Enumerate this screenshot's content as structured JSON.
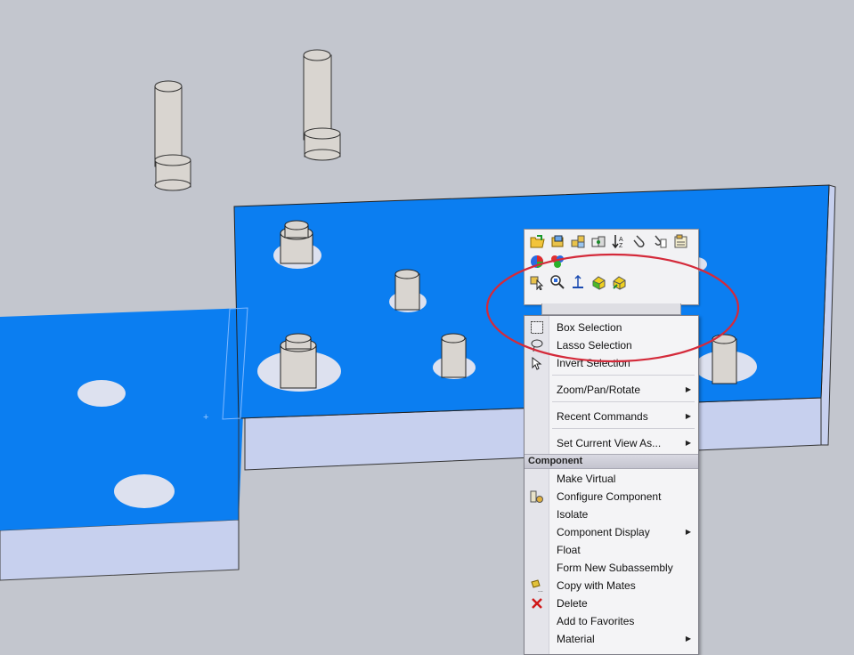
{
  "toolbar": {
    "icons": [
      "open-part-icon",
      "open-assembly-icon",
      "assembly-icon",
      "mates-icon",
      "sort-icon",
      "attach-icon",
      "attach-file-icon",
      "properties-icon",
      "appearance-icon",
      "color-icon",
      "select-other-icon",
      "zoom-to-selection-icon",
      "normal-to-icon",
      "hide-icon",
      "show-icon"
    ]
  },
  "menu": {
    "items": [
      {
        "label": "Box Selection",
        "icon": "box-selection-icon"
      },
      {
        "label": "Lasso Selection",
        "icon": "lasso-icon"
      },
      {
        "label": "Invert Selection",
        "icon": "invert-selection-icon"
      },
      {
        "label": "Zoom/Pan/Rotate",
        "submenu": true
      },
      {
        "label": "Recent Commands",
        "submenu": true
      },
      {
        "label": "Set Current View As...",
        "submenu": true
      }
    ],
    "section_header": "Component",
    "component_items": [
      {
        "label": "Make Virtual"
      },
      {
        "label": "Configure Component",
        "icon": "configure-icon"
      },
      {
        "label": "Isolate"
      },
      {
        "label": "Component Display",
        "submenu": true
      },
      {
        "label": "Float"
      },
      {
        "label": "Form New Subassembly"
      },
      {
        "label": "Copy with Mates",
        "icon": "copy-mates-icon"
      },
      {
        "label": "Delete",
        "icon": "delete-icon"
      },
      {
        "label": "Add to Favorites"
      },
      {
        "label": "Material",
        "submenu": true
      }
    ]
  },
  "colors": {
    "selected_face": "#0a7ef0",
    "background": "#c3c6ce",
    "annotation": "#d42a3a"
  }
}
